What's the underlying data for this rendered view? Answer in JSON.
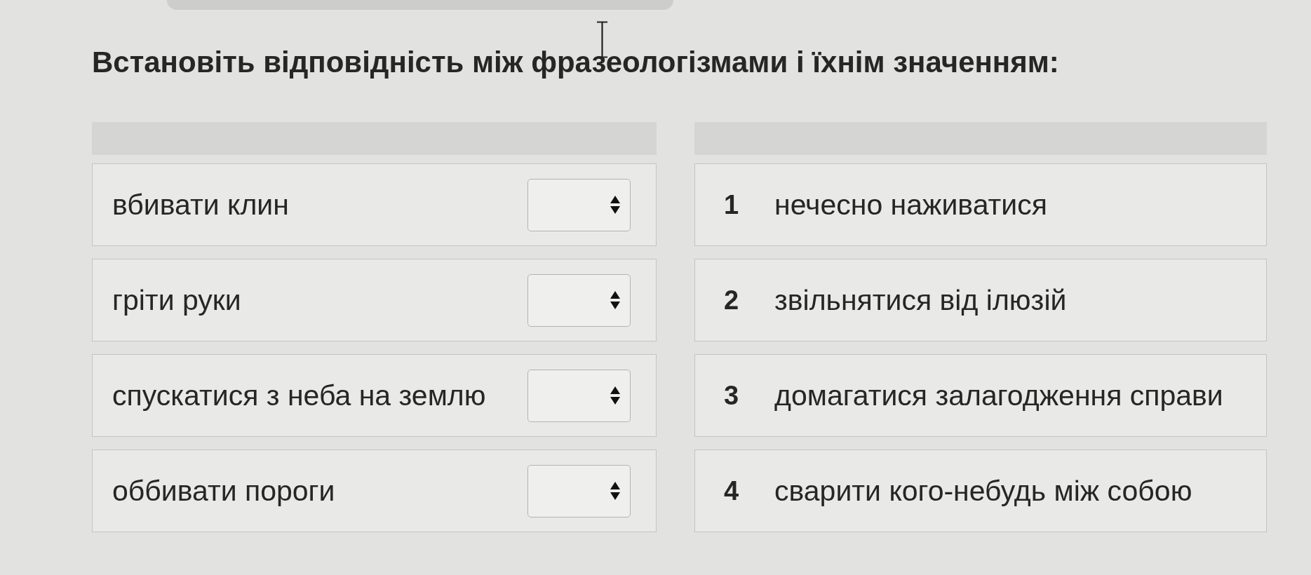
{
  "instruction": "Встановіть відповідність між фразеологізмами і їхнім значенням:",
  "phrases": [
    {
      "text": "вбивати клин"
    },
    {
      "text": "гріти руки"
    },
    {
      "text": "спускатися з неба на землю"
    },
    {
      "text": "оббивати пороги"
    }
  ],
  "meanings": [
    {
      "number": "1",
      "text": "нечесно наживатися"
    },
    {
      "number": "2",
      "text": "звільнятися від ілюзій"
    },
    {
      "number": "3",
      "text": "домагатися залагодження справи"
    },
    {
      "number": "4",
      "text": "сварити кого-небудь між собою"
    }
  ]
}
